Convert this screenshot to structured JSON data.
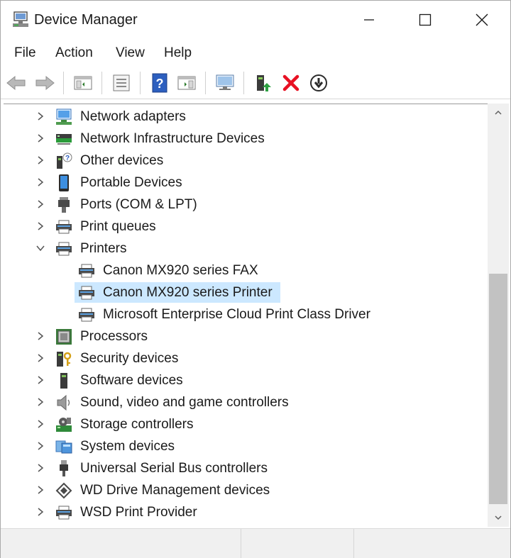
{
  "window": {
    "title": "Device Manager",
    "icons": {
      "app": "device-manager-icon",
      "minimize": "minimize-icon",
      "maximize": "maximize-icon",
      "close": "close-icon"
    }
  },
  "menu": {
    "items": [
      "File",
      "Action",
      "View",
      "Help"
    ]
  },
  "toolbar": {
    "buttons": [
      "back-icon",
      "forward-icon",
      "show-hide-console-tree-icon",
      "properties-icon",
      "help-icon",
      "action-pane-icon",
      "scan-hardware-changes-icon",
      "update-driver-icon",
      "uninstall-device-icon",
      "disable-device-icon"
    ]
  },
  "tree": {
    "items": [
      {
        "label": "Network adapters",
        "icon": "network-adapter-icon",
        "state": "collapsed"
      },
      {
        "label": "Network Infrastructure Devices",
        "icon": "network-infrastructure-icon",
        "state": "collapsed"
      },
      {
        "label": "Other devices",
        "icon": "other-devices-icon",
        "state": "collapsed"
      },
      {
        "label": "Portable Devices",
        "icon": "portable-device-icon",
        "state": "collapsed"
      },
      {
        "label": "Ports (COM & LPT)",
        "icon": "port-icon",
        "state": "collapsed"
      },
      {
        "label": "Print queues",
        "icon": "print-queue-icon",
        "state": "collapsed"
      },
      {
        "label": "Printers",
        "icon": "printer-icon",
        "state": "expanded"
      },
      {
        "label": "Canon MX920 series FAX",
        "icon": "printer-icon",
        "state": "child"
      },
      {
        "label": "Canon MX920 series Printer",
        "icon": "printer-icon",
        "state": "child-selected"
      },
      {
        "label": "Microsoft Enterprise Cloud Print Class Driver",
        "icon": "printer-icon",
        "state": "child"
      },
      {
        "label": "Processors",
        "icon": "processor-icon",
        "state": "collapsed"
      },
      {
        "label": "Security devices",
        "icon": "security-device-icon",
        "state": "collapsed"
      },
      {
        "label": "Software devices",
        "icon": "software-device-icon",
        "state": "collapsed"
      },
      {
        "label": "Sound, video and game controllers",
        "icon": "speaker-icon",
        "state": "collapsed"
      },
      {
        "label": "Storage controllers",
        "icon": "storage-controller-icon",
        "state": "collapsed"
      },
      {
        "label": "System devices",
        "icon": "system-device-icon",
        "state": "collapsed"
      },
      {
        "label": "Universal Serial Bus controllers",
        "icon": "usb-icon",
        "state": "collapsed"
      },
      {
        "label": "WD Drive Management devices",
        "icon": "wd-drive-icon",
        "state": "collapsed"
      },
      {
        "label": "WSD Print Provider",
        "icon": "printer-icon",
        "state": "collapsed"
      }
    ]
  },
  "colors": {
    "selection": "#cce8ff",
    "accent_blue": "#1f6fd1",
    "delete_red": "#e81123",
    "scroll_thumb": "#c2c2c2"
  }
}
